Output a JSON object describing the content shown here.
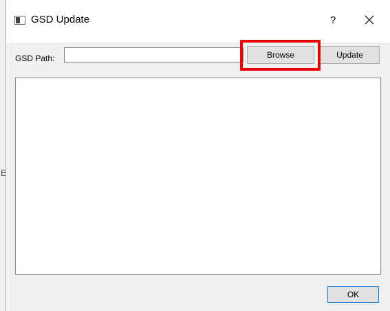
{
  "window": {
    "title": "GSD Update",
    "help_label": "?",
    "close_icon": "close-icon",
    "app_icon": "window-icon"
  },
  "form": {
    "path_label": "GSD Path:",
    "path_value": "",
    "browse_label": "Browse",
    "update_label": "Update"
  },
  "log": {
    "content": ""
  },
  "footer": {
    "ok_label": "OK"
  },
  "background": {
    "partial_text": "E"
  },
  "colors": {
    "highlight": "#e60000",
    "focus_border": "#0078d7"
  }
}
